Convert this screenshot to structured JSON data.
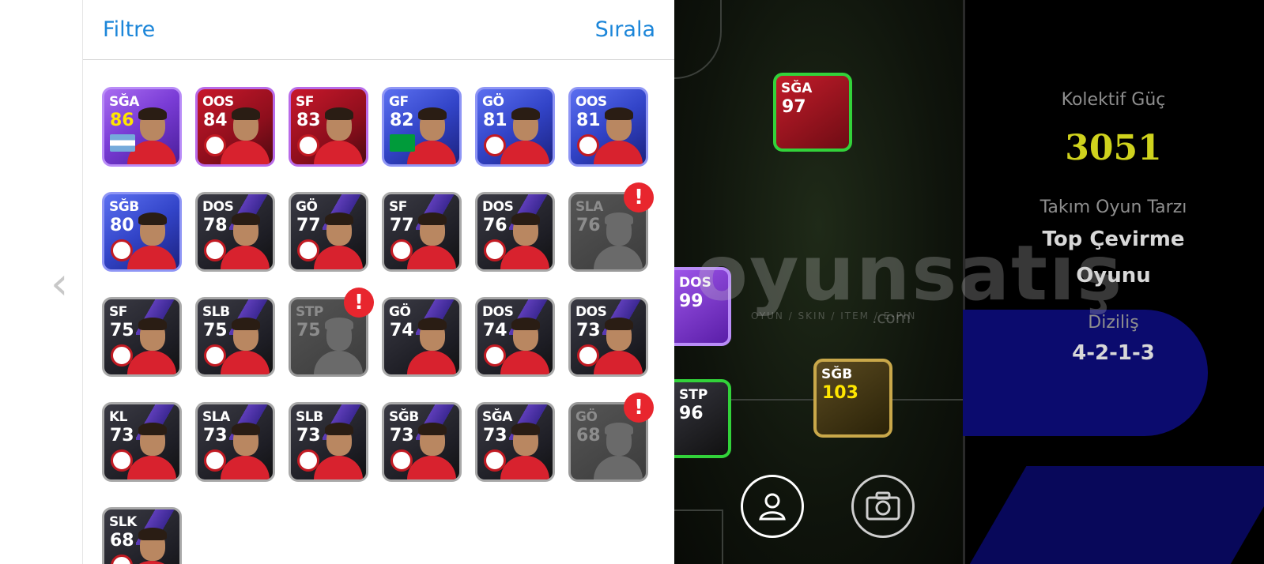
{
  "panel": {
    "filter_label": "Filtre",
    "sort_label": "Sırala",
    "back_icon": "chevron-left-icon"
  },
  "cards": [
    {
      "pos": "SĞA",
      "ovr": "86",
      "style": "purple",
      "gold": true,
      "emblem": "argentina-flag"
    },
    {
      "pos": "OOS",
      "ovr": "84",
      "style": "red",
      "gold": false,
      "emblem": "man-utd-badge"
    },
    {
      "pos": "SF",
      "ovr": "83",
      "style": "red",
      "gold": false,
      "emblem": "man-utd-badge"
    },
    {
      "pos": "GF",
      "ovr": "82",
      "style": "blue",
      "gold": false,
      "emblem": "brazil-flag"
    },
    {
      "pos": "GÖ",
      "ovr": "81",
      "style": "blue",
      "gold": false,
      "emblem": "fenerbahce-badge"
    },
    {
      "pos": "OOS",
      "ovr": "81",
      "style": "blue",
      "gold": false,
      "emblem": "como-badge"
    },
    {
      "pos": "SĞB",
      "ovr": "80",
      "style": "blue",
      "gold": false,
      "emblem": "club-badge"
    },
    {
      "pos": "DOS",
      "ovr": "78",
      "style": "dark",
      "gold": false,
      "emblem": "man-utd-badge"
    },
    {
      "pos": "GÖ",
      "ovr": "77",
      "style": "dark",
      "gold": false,
      "emblem": "club-badge"
    },
    {
      "pos": "SF",
      "ovr": "77",
      "style": "dark",
      "gold": false,
      "emblem": "fenerbahce-badge"
    },
    {
      "pos": "DOS",
      "ovr": "76",
      "style": "dark",
      "gold": false,
      "emblem": "club-badge"
    },
    {
      "pos": "SLA",
      "ovr": "76",
      "style": "gray",
      "gold": false,
      "emblem": "",
      "alert": "!"
    },
    {
      "pos": "SF",
      "ovr": "75",
      "style": "dark",
      "gold": false,
      "emblem": "frankfurt-badge"
    },
    {
      "pos": "SLB",
      "ovr": "75",
      "style": "dark",
      "gold": false,
      "emblem": "club-badge"
    },
    {
      "pos": "STP",
      "ovr": "75",
      "style": "gray",
      "gold": false,
      "emblem": "",
      "alert": "!"
    },
    {
      "pos": "GÖ",
      "ovr": "74",
      "style": "dark",
      "gold": false,
      "emblem": ""
    },
    {
      "pos": "DOS",
      "ovr": "74",
      "style": "dark",
      "gold": false,
      "emblem": "club-badge"
    },
    {
      "pos": "DOS",
      "ovr": "73",
      "style": "dark",
      "gold": false,
      "emblem": "club-badge"
    },
    {
      "pos": "KL",
      "ovr": "73",
      "style": "dark",
      "gold": false,
      "emblem": "club-badge"
    },
    {
      "pos": "SLA",
      "ovr": "73",
      "style": "dark",
      "gold": false,
      "emblem": "psv-badge"
    },
    {
      "pos": "SLB",
      "ovr": "73",
      "style": "dark",
      "gold": false,
      "emblem": "club-badge"
    },
    {
      "pos": "SĞB",
      "ovr": "73",
      "style": "dark",
      "gold": false,
      "emblem": "club-badge"
    },
    {
      "pos": "SĞA",
      "ovr": "73",
      "style": "dark",
      "gold": false,
      "emblem": "lazio-badge"
    },
    {
      "pos": "GÖ",
      "ovr": "68",
      "style": "gray",
      "gold": false,
      "emblem": "",
      "alert": "!"
    },
    {
      "pos": "SLK",
      "ovr": "68",
      "style": "dark",
      "gold": false,
      "emblem": "club-badge"
    }
  ],
  "pitch": {
    "cards": [
      {
        "pos": "SĞA",
        "ovr": "97"
      },
      {
        "pos": "DOS",
        "ovr": "99"
      },
      {
        "pos": "STP",
        "ovr": "96"
      },
      {
        "pos": "SĞB",
        "ovr": "103"
      }
    ],
    "person_icon": "person-icon",
    "camera_icon": "camera-icon"
  },
  "stats": {
    "power_label": "Kolektif Güç",
    "power_value": "3051",
    "style_label": "Takım Oyun Tarzı",
    "style_value_1": "Top Çevirme",
    "style_value_2": "Oyunu",
    "formation_label": "Diziliş",
    "formation_value": "4-2-1-3"
  },
  "watermark": {
    "main": "oyunsatış",
    "sub": "OYUN / SKIN / ITEM / E-PIN",
    "com": ".com"
  }
}
